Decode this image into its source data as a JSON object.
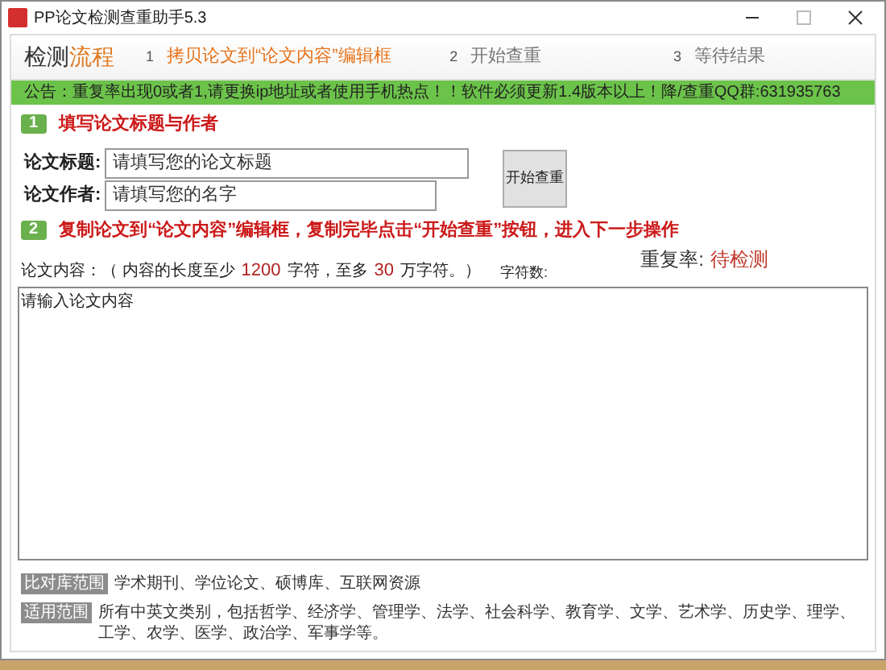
{
  "window": {
    "title": "PP论文检测查重助手5.3"
  },
  "process": {
    "title_a": "检测",
    "title_b": "流程"
  },
  "steps": [
    {
      "number": "1",
      "label": "拷贝论文到“论文内容”编辑框",
      "selected": true
    },
    {
      "number": "2",
      "label": "开始查重",
      "selected": false
    },
    {
      "number": "3",
      "label": "等待结果",
      "selected": false
    }
  ],
  "notice": "公告：重复率出现0或者1,请更换ip地址或者使用手机热点！！软件必须更新1.4版本以上！降/查重QQ群:631935763",
  "section1": {
    "badge": "1",
    "title": "填写论文标题与作者"
  },
  "fields": [
    {
      "label": "论文标题:",
      "placeholder": "请填写您的论文标题"
    },
    {
      "label": "论文作者:",
      "placeholder": "请填写您的名字"
    }
  ],
  "start_button": "开始查重",
  "section2": {
    "badge": "2",
    "title": "复制论文到“论文内容”编辑框，复制完毕点击“开始查重”按钮，进入下一步操作"
  },
  "content_label": [
    {
      "text": "论文内容：（ 内容的长度至少",
      "highlight": false
    },
    {
      "text": "1200",
      "highlight": true
    },
    {
      "text": "字符，至多",
      "highlight": false
    },
    {
      "text": "30",
      "highlight": true
    },
    {
      "text": "万字符。）",
      "highlight": false
    }
  ],
  "char_count_label": "字符数:",
  "rate": {
    "label": "重复率:",
    "value": "待检测"
  },
  "content": {
    "placeholder": "请输入论文内容"
  },
  "footer": [
    {
      "tag": "比对库范围",
      "text": "学术期刊、学位论文、硕博库、互联网资源"
    },
    {
      "tag": "适用范围",
      "text": "所有中英文类别，包括哲学、经济学、管理学、法学、社会科学、教育学、文学、艺术学、历史学、理学、工学、农学、医学、政治学、军事学等。"
    }
  ]
}
